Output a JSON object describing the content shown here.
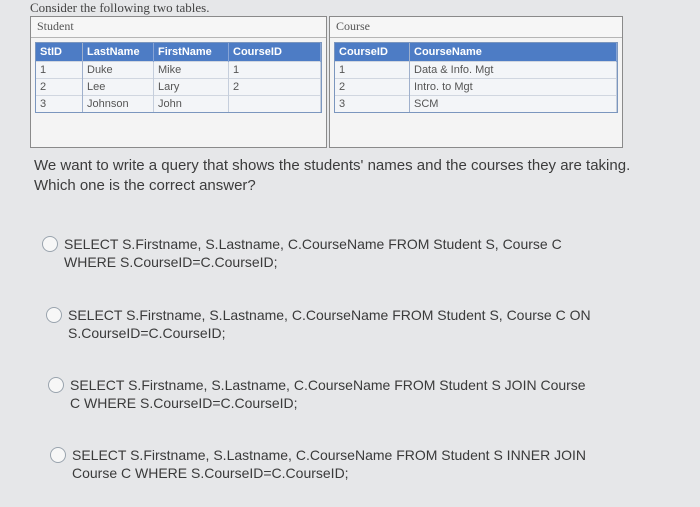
{
  "intro": "Consider the following two tables.",
  "student": {
    "label": "Student",
    "headers": [
      "StID",
      "LastName",
      "FirstName",
      "CourseID"
    ],
    "rows": [
      [
        "1",
        "Duke",
        "Mike",
        "1"
      ],
      [
        "2",
        "Lee",
        "Lary",
        "2"
      ],
      [
        "3",
        "Johnson",
        "John",
        ""
      ]
    ]
  },
  "course": {
    "label": "Course",
    "headers": [
      "CourseID",
      "CourseName"
    ],
    "rows": [
      [
        "1",
        "Data & Info. Mgt"
      ],
      [
        "2",
        "Intro. to Mgt"
      ],
      [
        "3",
        "SCM"
      ]
    ]
  },
  "question": "We want to write a query that shows the students' names and the courses they are taking. Which one is the correct answer?",
  "options": [
    {
      "line1": "SELECT S.Firstname, S.Lastname, C.CourseName FROM Student S, Course C",
      "line2": "WHERE S.CourseID=C.CourseID;"
    },
    {
      "line1": "SELECT S.Firstname, S.Lastname, C.CourseName FROM Student S, Course C ON",
      "line2": "S.CourseID=C.CourseID;"
    },
    {
      "line1": "SELECT S.Firstname, S.Lastname, C.CourseName FROM Student S JOIN Course",
      "line2": "C WHERE S.CourseID=C.CourseID;"
    },
    {
      "line1": "SELECT S.Firstname, S.Lastname, C.CourseName FROM Student S INNER JOIN",
      "line2": "Course C WHERE S.CourseID=C.CourseID;"
    }
  ]
}
